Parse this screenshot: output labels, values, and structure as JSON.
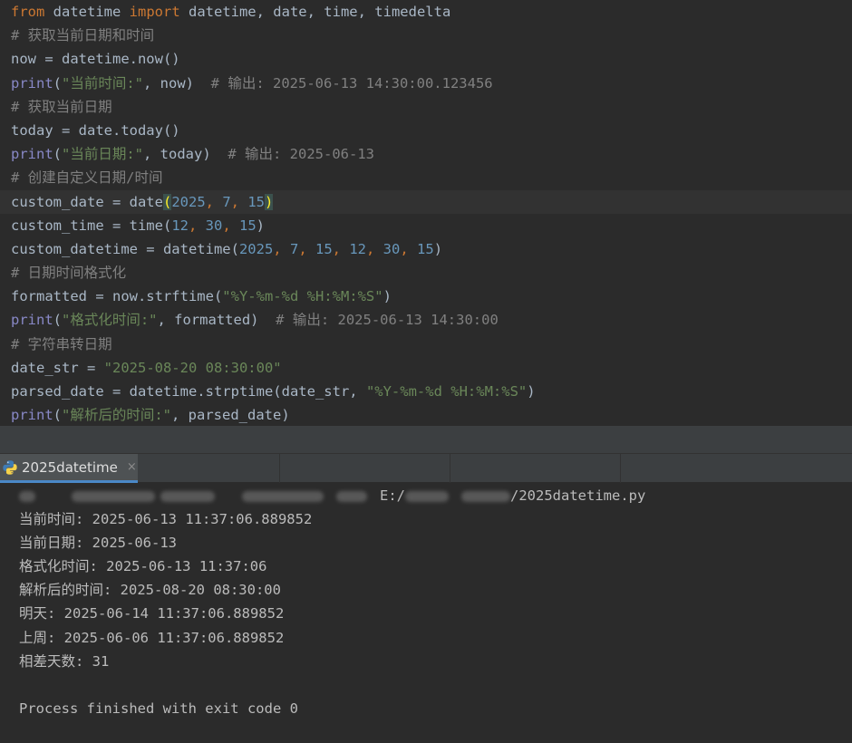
{
  "editor": {
    "lines": [
      {
        "tokens": [
          {
            "t": "from",
            "c": "kw"
          },
          {
            "t": " datetime ",
            "c": "plain"
          },
          {
            "t": "import",
            "c": "kw"
          },
          {
            "t": " datetime, date, time, timedelta",
            "c": "plain"
          }
        ]
      },
      {
        "tokens": [
          {
            "t": "# 获取当前日期和时间",
            "c": "cmt"
          }
        ]
      },
      {
        "tokens": [
          {
            "t": "now = datetime.now()",
            "c": "plain"
          }
        ]
      },
      {
        "tokens": [
          {
            "t": "print",
            "c": "fn"
          },
          {
            "t": "(",
            "c": "plain"
          },
          {
            "t": "\"当前时间:\"",
            "c": "str"
          },
          {
            "t": ", now)  ",
            "c": "plain"
          },
          {
            "t": "# 输出: 2025-06-13 14:30:00.123456",
            "c": "cmt"
          }
        ]
      },
      {
        "tokens": [
          {
            "t": "# 获取当前日期",
            "c": "cmt"
          }
        ]
      },
      {
        "tokens": [
          {
            "t": "today = date.today()",
            "c": "plain"
          }
        ]
      },
      {
        "tokens": [
          {
            "t": "print",
            "c": "fn"
          },
          {
            "t": "(",
            "c": "plain"
          },
          {
            "t": "\"当前日期:\"",
            "c": "str"
          },
          {
            "t": ", today)  ",
            "c": "plain"
          },
          {
            "t": "# 输出: 2025-06-13",
            "c": "cmt"
          }
        ]
      },
      {
        "tokens": [
          {
            "t": "# 创建自定义日期/时间",
            "c": "cmt"
          }
        ]
      },
      {
        "current": true,
        "tokens": [
          {
            "t": "custom_date = date",
            "c": "plain"
          },
          {
            "t": "(",
            "c": "paren-hl"
          },
          {
            "t": "2025",
            "c": "num"
          },
          {
            "t": ", ",
            "c": "kw"
          },
          {
            "t": "7",
            "c": "num"
          },
          {
            "t": ", ",
            "c": "kw"
          },
          {
            "t": "15",
            "c": "num"
          },
          {
            "t": ")",
            "c": "paren-hl"
          }
        ]
      },
      {
        "tokens": [
          {
            "t": "custom_time = time(",
            "c": "plain"
          },
          {
            "t": "12",
            "c": "num"
          },
          {
            "t": ", ",
            "c": "kw"
          },
          {
            "t": "30",
            "c": "num"
          },
          {
            "t": ", ",
            "c": "kw"
          },
          {
            "t": "15",
            "c": "num"
          },
          {
            "t": ")",
            "c": "plain"
          }
        ]
      },
      {
        "tokens": [
          {
            "t": "custom_datetime = datetime(",
            "c": "plain"
          },
          {
            "t": "2025",
            "c": "num"
          },
          {
            "t": ", ",
            "c": "kw"
          },
          {
            "t": "7",
            "c": "num"
          },
          {
            "t": ", ",
            "c": "kw"
          },
          {
            "t": "15",
            "c": "num"
          },
          {
            "t": ", ",
            "c": "kw"
          },
          {
            "t": "12",
            "c": "num"
          },
          {
            "t": ", ",
            "c": "kw"
          },
          {
            "t": "30",
            "c": "num"
          },
          {
            "t": ", ",
            "c": "kw"
          },
          {
            "t": "15",
            "c": "num"
          },
          {
            "t": ")",
            "c": "plain"
          }
        ]
      },
      {
        "tokens": [
          {
            "t": "# 日期时间格式化",
            "c": "cmt"
          }
        ]
      },
      {
        "tokens": [
          {
            "t": "formatted = now.strftime(",
            "c": "plain"
          },
          {
            "t": "\"%Y-%m-%d %H:%M:%S\"",
            "c": "str"
          },
          {
            "t": ")",
            "c": "plain"
          }
        ]
      },
      {
        "tokens": [
          {
            "t": "print",
            "c": "fn"
          },
          {
            "t": "(",
            "c": "plain"
          },
          {
            "t": "\"格式化时间:\"",
            "c": "str"
          },
          {
            "t": ", formatted)  ",
            "c": "plain"
          },
          {
            "t": "# 输出: 2025-06-13 14:30:00",
            "c": "cmt"
          }
        ]
      },
      {
        "tokens": [
          {
            "t": "# 字符串转日期",
            "c": "cmt"
          }
        ]
      },
      {
        "tokens": [
          {
            "t": "date_str = ",
            "c": "plain"
          },
          {
            "t": "\"2025-08-20 08:30:00\"",
            "c": "str"
          }
        ]
      },
      {
        "tokens": [
          {
            "t": "parsed_date = datetime.strptime(date_str, ",
            "c": "plain"
          },
          {
            "t": "\"%Y-%m-%d %H:%M:%S\"",
            "c": "str"
          },
          {
            "t": ")",
            "c": "plain"
          }
        ]
      },
      {
        "tokens": [
          {
            "t": "print",
            "c": "fn"
          },
          {
            "t": "(",
            "c": "plain"
          },
          {
            "t": "\"解析后的时间:\"",
            "c": "str"
          },
          {
            "t": ", parsed_date)",
            "c": "plain"
          }
        ]
      }
    ]
  },
  "run_tab": {
    "label": "2025datetime",
    "close": "×",
    "colors": {
      "accent": "#4a88c7",
      "python_blue": "#3f7cb5",
      "python_yellow": "#f6d24a"
    }
  },
  "console": {
    "command_visible": "E:/",
    "command_tail": "/2025datetime.py",
    "lines": [
      "当前时间: 2025-06-13 11:37:06.889852",
      "当前日期: 2025-06-13",
      "格式化时间: 2025-06-13 11:37:06",
      "解析后的时间: 2025-08-20 08:30:00",
      "明天: 2025-06-14 11:37:06.889852",
      "上周: 2025-06-06 11:37:06.889852",
      "相差天数: 31",
      "",
      "Process finished with exit code 0"
    ]
  }
}
